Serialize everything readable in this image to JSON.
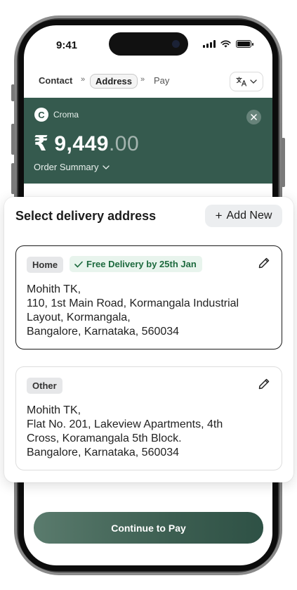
{
  "status_bar": {
    "time": "9:41"
  },
  "stepper": {
    "steps": [
      {
        "label": "Contact"
      },
      {
        "label": "Address"
      },
      {
        "label": "Pay"
      }
    ],
    "separator": "»"
  },
  "merchant": {
    "logo_letter": "C",
    "name": "Croma",
    "currency": "₹",
    "amount_whole": "9,449",
    "amount_decimal": ".00",
    "order_summary_label": "Order Summary"
  },
  "address_sheet": {
    "title": "Select delivery address",
    "add_new_label": "Add New",
    "addresses": [
      {
        "tag": "Home",
        "badge": "Free Delivery by 25th Jan",
        "selected": true,
        "lines": [
          "Mohith TK,",
          "110, 1st Main Road, Kormangala Industrial",
          "Layout, Kormangala,",
          "Bangalore, Karnataka, 560034"
        ]
      },
      {
        "tag": "Other",
        "selected": false,
        "lines": [
          "Mohith TK,",
          "Flat No. 201, Lakeview Apartments, 4th",
          "Cross, Koramangala 5th Block.",
          "Bangalore, Karnataka, 560034"
        ]
      }
    ]
  },
  "footer": {
    "continue_label": "Continue to Pay"
  },
  "colors": {
    "brand_green": "#355a4e",
    "badge_green_text": "#1d6a3e",
    "badge_green_bg": "#e8f4ed"
  }
}
